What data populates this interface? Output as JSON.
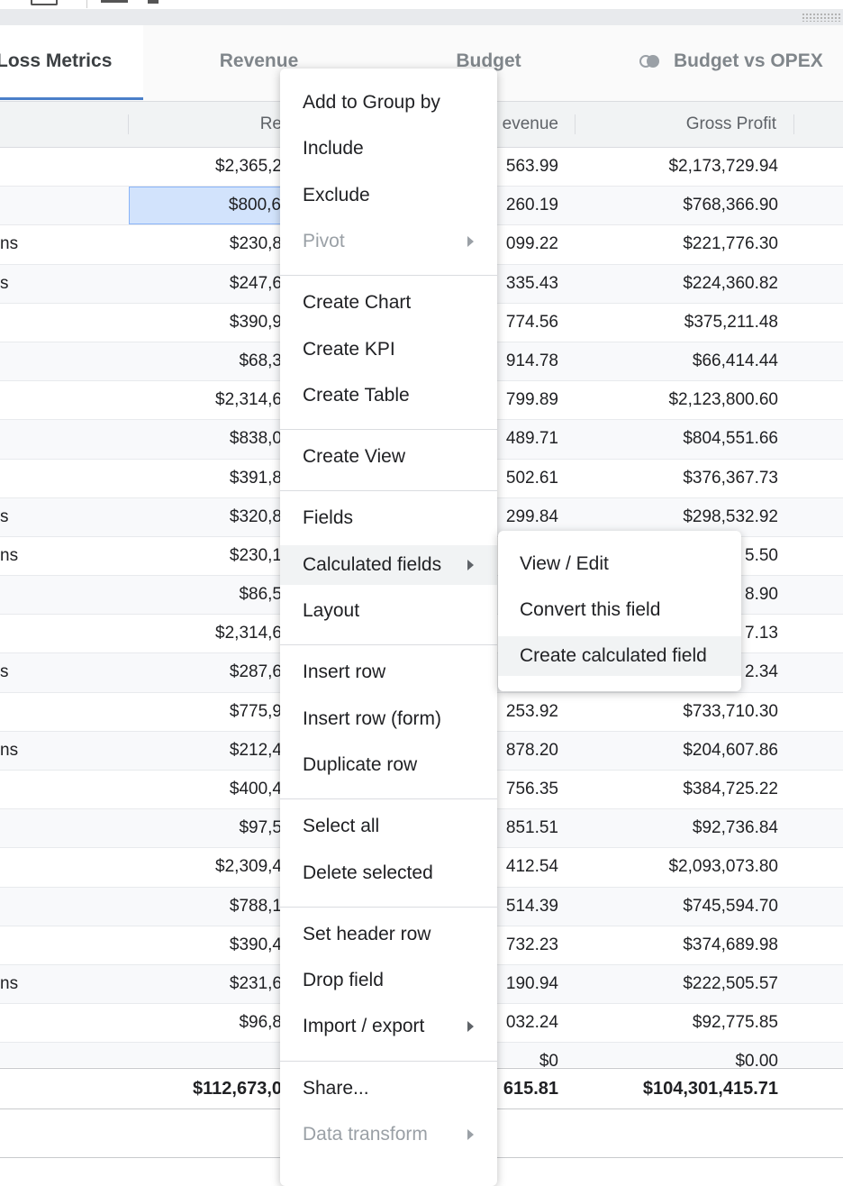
{
  "tabs": [
    {
      "label": "Loss Metrics",
      "active": true
    },
    {
      "label": "Revenue",
      "active": false
    },
    {
      "label": "Budget",
      "active": false
    },
    {
      "label": "Budget vs OPEX",
      "active": false,
      "icon": "toggle-icon"
    }
  ],
  "columns": [
    "Re",
    "evenue",
    "Gross Profit"
  ],
  "rows": [
    {
      "c0": "",
      "c1": "$2,365,2",
      "c2": "563.99",
      "c3": "$2,173,729.94"
    },
    {
      "c0": "",
      "c1": "$800,6",
      "c2": "260.19",
      "c3": "$768,366.90",
      "selected": true
    },
    {
      "c0": "ns",
      "c1": "$230,8",
      "c2": "099.22",
      "c3": "$221,776.30"
    },
    {
      "c0": "s",
      "c1": "$247,6",
      "c2": "335.43",
      "c3": "$224,360.82"
    },
    {
      "c0": "",
      "c1": "$390,9",
      "c2": "774.56",
      "c3": "$375,211.48"
    },
    {
      "c0": "",
      "c1": "$68,3",
      "c2": "914.78",
      "c3": "$66,414.44"
    },
    {
      "c0": "",
      "c1": "$2,314,6",
      "c2": "799.89",
      "c3": "$2,123,800.60"
    },
    {
      "c0": "",
      "c1": "$838,0",
      "c2": "489.71",
      "c3": "$804,551.66"
    },
    {
      "c0": "",
      "c1": "$391,8",
      "c2": "502.61",
      "c3": "$376,367.73"
    },
    {
      "c0": "s",
      "c1": "$320,8",
      "c2": "299.84",
      "c3": "$298,532.92"
    },
    {
      "c0": "ns",
      "c1": "$230,1",
      "c2": "",
      "c3": "5.50"
    },
    {
      "c0": "",
      "c1": "$86,5",
      "c2": "",
      "c3": "8.90"
    },
    {
      "c0": "",
      "c1": "$2,314,6",
      "c2": "",
      "c3": "7.13"
    },
    {
      "c0": "s",
      "c1": "$287,6",
      "c2": "",
      "c3": "2.34"
    },
    {
      "c0": "",
      "c1": "$775,9",
      "c2": "253.92",
      "c3": "$733,710.30"
    },
    {
      "c0": "ns",
      "c1": "$212,4",
      "c2": "878.20",
      "c3": "$204,607.86"
    },
    {
      "c0": "",
      "c1": "$400,4",
      "c2": "756.35",
      "c3": "$384,725.22"
    },
    {
      "c0": "",
      "c1": "$97,5",
      "c2": "851.51",
      "c3": "$92,736.84"
    },
    {
      "c0": "",
      "c1": "$2,309,4",
      "c2": "412.54",
      "c3": "$2,093,073.80"
    },
    {
      "c0": "",
      "c1": "$788,1",
      "c2": "514.39",
      "c3": "$745,594.70"
    },
    {
      "c0": "",
      "c1": "$390,4",
      "c2": "732.23",
      "c3": "$374,689.98"
    },
    {
      "c0": "ns",
      "c1": "$231,6",
      "c2": "190.94",
      "c3": "$222,505.57"
    },
    {
      "c0": "",
      "c1": "$96,8",
      "c2": "032.24",
      "c3": "$92,775.85"
    },
    {
      "c0": "",
      "c1": "",
      "c2": "$0",
      "c3": "$0.00"
    }
  ],
  "totals": {
    "c1": "$112,673,0",
    "c2": "615.81",
    "c3": "$104,301,415.71"
  },
  "context_menu": {
    "items": [
      {
        "label": "Add to Group by"
      },
      {
        "label": "Include"
      },
      {
        "label": "Exclude"
      },
      {
        "label": "Pivot",
        "disabled": true,
        "submenu": true
      },
      {
        "separator": true
      },
      {
        "label": "Create Chart"
      },
      {
        "label": "Create KPI"
      },
      {
        "label": "Create Table"
      },
      {
        "separator": true
      },
      {
        "label": "Create View"
      },
      {
        "separator": true
      },
      {
        "label": "Fields"
      },
      {
        "label": "Calculated fields",
        "submenu": true,
        "active": true
      },
      {
        "label": "Layout"
      },
      {
        "separator": true
      },
      {
        "label": "Insert row"
      },
      {
        "label": "Insert row (form)"
      },
      {
        "label": "Duplicate row"
      },
      {
        "separator": true
      },
      {
        "label": "Select all"
      },
      {
        "label": "Delete selected"
      },
      {
        "separator": true
      },
      {
        "label": "Set header row"
      },
      {
        "label": "Drop field"
      },
      {
        "label": "Import / export",
        "submenu": true
      },
      {
        "separator": true
      },
      {
        "label": "Share..."
      },
      {
        "label": "Data transform",
        "disabled": true,
        "submenu": true
      }
    ]
  },
  "submenu": {
    "items": [
      {
        "label": "View / Edit"
      },
      {
        "label": "Convert this field"
      },
      {
        "label": "Create calculated field",
        "hover": true
      }
    ]
  }
}
